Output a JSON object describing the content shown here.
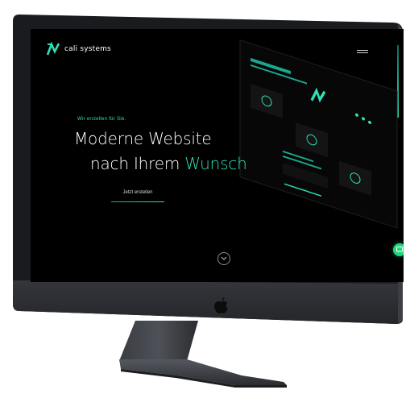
{
  "site": {
    "logo_text": "cali systems",
    "kicker": "Wir erstellen für Sie.",
    "headline_line1": "Moderne Website",
    "headline_line2_prefix": "nach Ihrem ",
    "headline_line2_accent": "Wunsch",
    "cta_label": "Jetzt erstellen"
  },
  "icons": {
    "logo": "cali-logo-icon",
    "menu": "hamburger-menu-icon",
    "scroll": "chevron-down-icon",
    "chat": "chat-icon",
    "device_brand": "apple-logo-icon"
  },
  "colors": {
    "accent": "#2fe0b6",
    "chat": "#20d67a",
    "screen_bg": "#000000",
    "bezel": "#2a2c31"
  }
}
